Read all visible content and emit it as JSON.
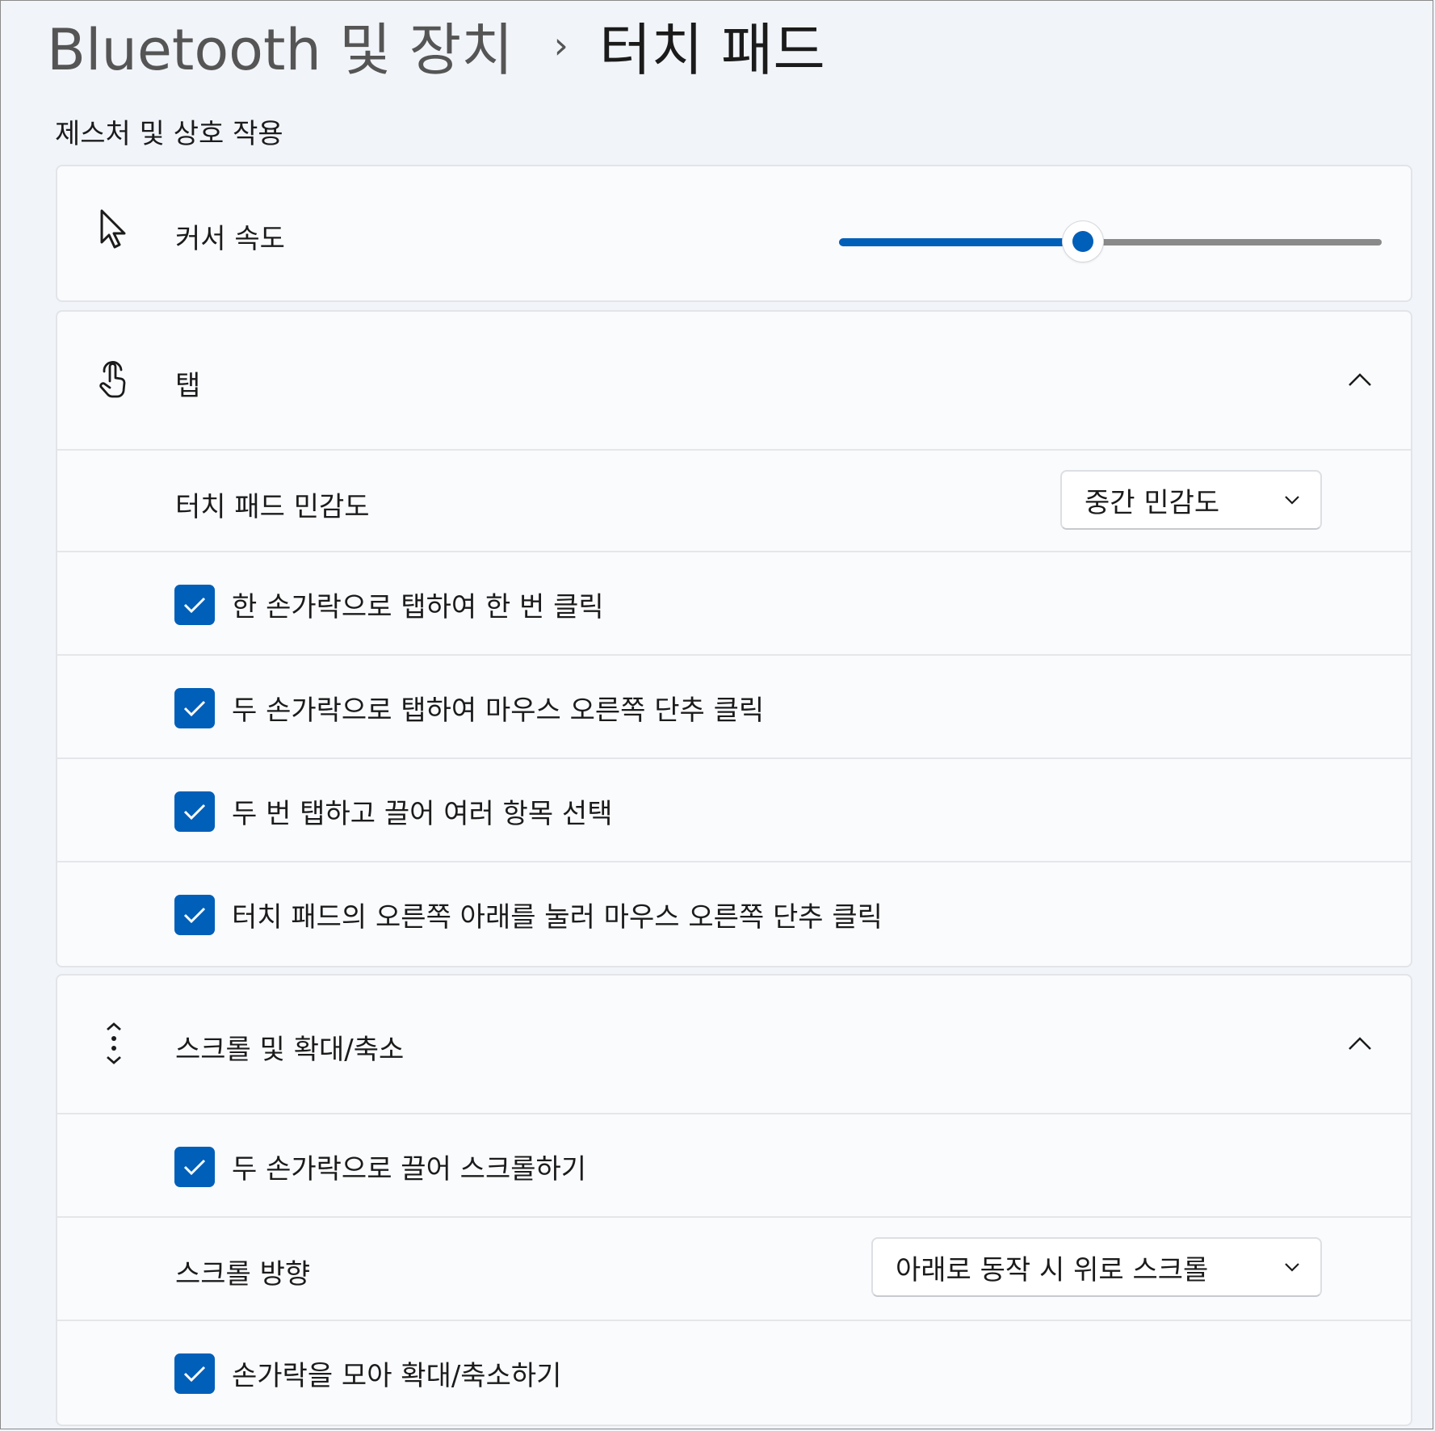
{
  "breadcrumb": {
    "parent": "Bluetooth 및 장치",
    "separator": "›",
    "current": "터치 패드"
  },
  "section_title": "제스처 및 상호 작용",
  "cursor_speed": {
    "label": "커서 속도",
    "icon": "cursor-arrow-icon",
    "slider_value_fraction": 0.45
  },
  "tap": {
    "header_label": "탭",
    "icon": "touch-hand-icon",
    "sensitivity_label": "터치 패드 민감도",
    "sensitivity_value": "중간 민감도",
    "options": [
      {
        "label": "한 손가락으로 탭하여 한 번 클릭",
        "checked": true
      },
      {
        "label": "두 손가락으로 탭하여 마우스 오른쪽 단추 클릭",
        "checked": true
      },
      {
        "label": "두 번 탭하고 끌어 여러 항목 선택",
        "checked": true
      },
      {
        "label": "터치 패드의 오른쪽 아래를 눌러 마우스 오른쪽 단추 클릭",
        "checked": true
      }
    ]
  },
  "scroll": {
    "header_label": "스크롤 및 확대/축소",
    "icon": "scroll-arrows-icon",
    "two_finger_scroll": {
      "label": "두 손가락으로 끌어 스크롤하기",
      "checked": true
    },
    "direction_label": "스크롤 방향",
    "direction_value": "아래로 동작 시 위로 스크롤",
    "pinch_zoom": {
      "label": "손가락을 모아 확대/축소하기",
      "checked": true
    }
  },
  "colors": {
    "accent": "#005fb8",
    "background": "#f1f4f9",
    "card": "#fafbfd"
  }
}
